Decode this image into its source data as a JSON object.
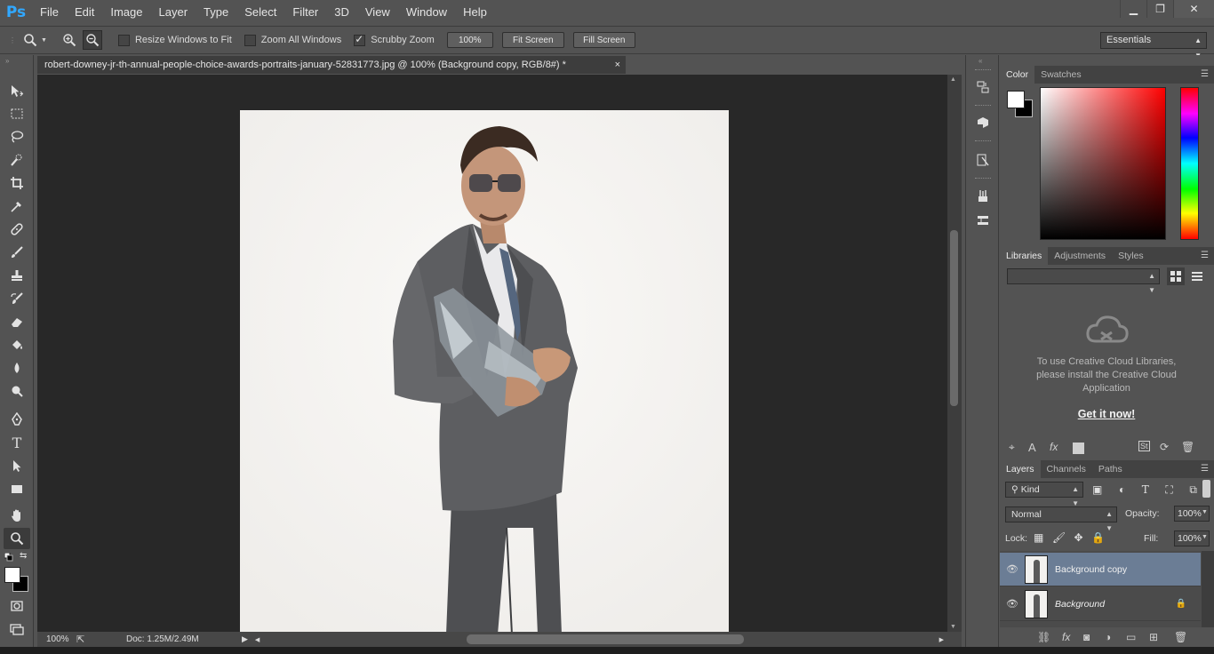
{
  "app": {
    "logo": "Ps"
  },
  "menu": [
    "File",
    "Edit",
    "Image",
    "Layer",
    "Type",
    "Select",
    "Filter",
    "3D",
    "View",
    "Window",
    "Help"
  ],
  "window_controls": {
    "minimize": "▁",
    "restore": "❐",
    "close": "✕"
  },
  "options": {
    "resize_windows": {
      "label": "Resize Windows to Fit",
      "checked": false
    },
    "zoom_all": {
      "label": "Zoom All Windows",
      "checked": false
    },
    "scrubby_zoom": {
      "label": "Scrubby Zoom",
      "checked": true
    },
    "zoom_value": "100%",
    "fit_screen": "Fit Screen",
    "fill_screen": "Fill Screen",
    "workspace": "Essentials"
  },
  "document": {
    "tab_title": "robert-downey-jr-th-annual-people-choice-awards-portraits-january-52831773.jpg @ 100% (Background copy, RGB/8#) *",
    "close": "×"
  },
  "status": {
    "zoom": "100%",
    "doc_size": "Doc: 1.25M/2.49M"
  },
  "panels": {
    "color_tabs": [
      "Color",
      "Swatches"
    ],
    "colors": {
      "foreground": "#ffffff",
      "background": "#000000"
    },
    "library_tabs": [
      "Libraries",
      "Adjustments",
      "Styles"
    ],
    "libraries_message": "To use Creative Cloud Libraries, please install the Creative Cloud Application",
    "libraries_link": "Get it now!",
    "layers_tabs": [
      "Layers",
      "Channels",
      "Paths"
    ],
    "filter_kind": "Kind",
    "blend_mode": "Normal",
    "opacity_label": "Opacity:",
    "opacity": "100%",
    "lock_label": "Lock:",
    "fill_label": "Fill:",
    "fill": "100%",
    "layers": [
      {
        "name": "Background copy",
        "selected": true,
        "locked": false
      },
      {
        "name": "Background",
        "selected": false,
        "locked": true
      }
    ]
  },
  "accent_colors": {
    "selection": "#6b7d95",
    "brand": "#31a8ff"
  }
}
